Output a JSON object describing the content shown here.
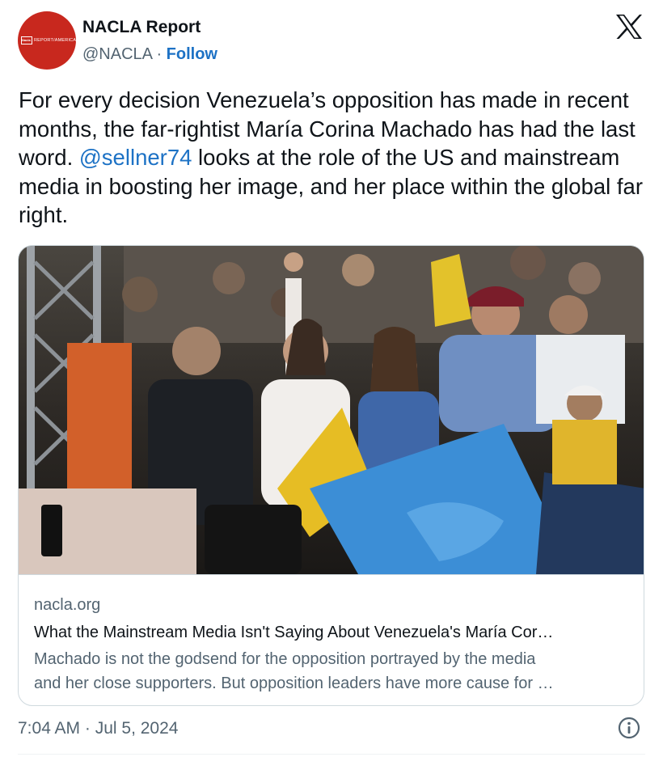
{
  "author": {
    "display_name": "NACLA Report",
    "handle": "@NACLA",
    "separator": " · ",
    "follow_label": "Follow",
    "avatar": {
      "logo_box_text": "Nacla",
      "logo_tagline": "REPORT/AMERICAS",
      "color": "#c8281e"
    }
  },
  "platform_icon": "x-logo-icon",
  "tweet": {
    "text_before": "For every decision Venezuela’s opposition has made in recent months, the far-rightist María Corina Machado has had the last word. ",
    "mention": "@sellner74",
    "text_after": " looks at the role of the US and mainstream media in boosting her image, and her place within the global far right."
  },
  "card": {
    "image_subject": "rally-crowd-photo",
    "domain": "nacla.org",
    "title": "What the Mainstream Media Isn't Saying About Venezuela's María Cor…",
    "description_lines": [
      "Machado is not the godsend for the opposition portrayed by the media",
      "and her close supporters. But opposition leaders have more cause for …"
    ]
  },
  "footer": {
    "timestamp": "7:04 AM · Jul 5, 2024",
    "info_icon": "info-icon"
  },
  "colors": {
    "link": "#1d72c5",
    "secondary_text": "#536471",
    "border": "#cfd9de"
  }
}
